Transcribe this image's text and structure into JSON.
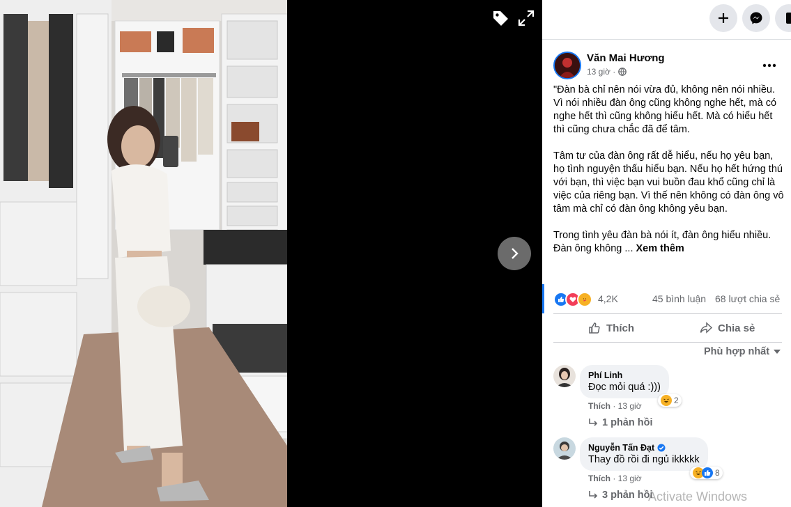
{
  "viewer": {
    "tag_icon": "tag-icon",
    "expand_icon": "expand-icon",
    "next_icon": "chevron-right-icon"
  },
  "topbar": {
    "create_icon": "plus-icon",
    "messenger_icon": "messenger-icon"
  },
  "post": {
    "author": "Văn Mai Hương",
    "time": "13 giờ ·",
    "privacy_icon": "globe-icon",
    "paragraphs": [
      "\"Đàn bà chỉ nên nói vừa đủ, không nên nói nhiều. Vì nói nhiều đàn ông cũng không nghe hết, mà có nghe hết thì cũng không hiểu hết. Mà có hiểu hết thì cũng chưa chắc đã để tâm.",
      "Tâm tư của đàn ông rất dễ hiểu, nếu họ yêu bạn, họ tình nguyện thấu hiểu bạn. Nếu họ hết hứng thú với bạn, thì việc bạn vui buồn đau khổ cũng chỉ là việc của riêng bạn. Vì thế nên không có đàn ông vô tâm mà chỉ có đàn ông không yêu bạn.",
      "Trong tình yêu đàn bà nói ít, đàn ông hiểu nhiều. Đàn ông không ..."
    ],
    "see_more": "Xem thêm",
    "reaction_count": "4,2K",
    "comment_count": "45 bình luận",
    "share_count": "68 lượt chia sẻ",
    "like_label": "Thích",
    "share_label": "Chia sẻ",
    "sort_label": "Phù hợp nhất"
  },
  "comments": [
    {
      "name": "Phí Linh",
      "text": "Đọc mỏi quá :)))",
      "like": "Thích",
      "time": "· 13 giờ",
      "react_count": "2",
      "replies": "1 phản hồi"
    },
    {
      "name": "Nguyễn Tấn Đạt",
      "text": "Thay đồ rồi đi ngủ ikkkkk",
      "like": "Thích",
      "time": "· 13 giờ",
      "react_count": "8",
      "replies": "3 phản hồi"
    }
  ],
  "watermark": "Activate Windows",
  "colors": {
    "accent": "#1877f2",
    "muted": "#65676b",
    "bubble": "#f0f2f5"
  }
}
